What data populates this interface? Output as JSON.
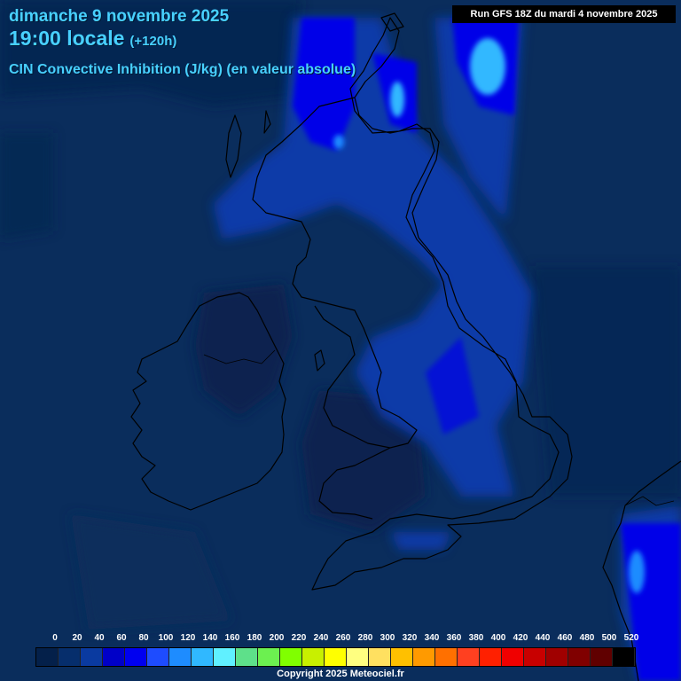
{
  "header": {
    "date": "dimanche 9 novembre 2025",
    "time": "19:00 locale",
    "offset": "(+120h)",
    "parameter": "CIN Convective Inhibition (J/kg) (en valeur absolue)",
    "run": "Run GFS 18Z du mardi 4 novembre 2025"
  },
  "legend": {
    "labels": [
      "0",
      "20",
      "40",
      "60",
      "80",
      "100",
      "120",
      "140",
      "160",
      "180",
      "200",
      "220",
      "240",
      "260",
      "280",
      "300",
      "320",
      "340",
      "360",
      "380",
      "400",
      "420",
      "440",
      "460",
      "480",
      "500",
      "520"
    ],
    "colors": [
      "#04204a",
      "#062e6c",
      "#0a3aa0",
      "#0000c8",
      "#0000f0",
      "#1e4cff",
      "#1e8cff",
      "#30b8ff",
      "#60f0ff",
      "#5ee08a",
      "#6cf050",
      "#80ff00",
      "#c8f000",
      "#ffff00",
      "#ffff80",
      "#ffe060",
      "#ffc000",
      "#ff9a00",
      "#ff7000",
      "#ff4020",
      "#ff2000",
      "#f00000",
      "#c80000",
      "#a00000",
      "#800000",
      "#600000",
      "#000000"
    ]
  },
  "copyright": "Copyright 2025 Meteociel.fr",
  "colors": {
    "background": "#0a2a55",
    "title": "#48d0ff",
    "coast": "#000000"
  }
}
